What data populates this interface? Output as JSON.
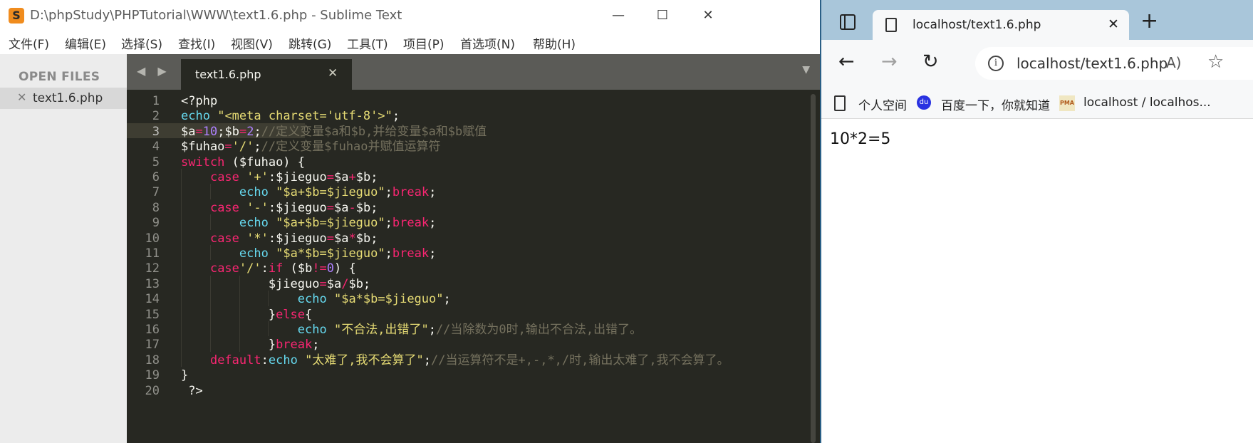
{
  "sublime": {
    "title": "D:\\phpStudy\\PHPTutorial\\WWW\\text1.6.php - Sublime Text",
    "app_icon_glyph": "S",
    "controls": {
      "minimize": "—",
      "maximize": "☐",
      "close": "✕"
    },
    "menu": [
      "文件(F)",
      "编辑(E)",
      "选择(S)",
      "查找(I)",
      "视图(V)",
      "跳转(G)",
      "工具(T)",
      "项目(P)",
      "首选项(N)",
      "帮助(H)"
    ],
    "sidebar": {
      "header": "OPEN FILES",
      "file_close": "✕",
      "file": "text1.6.php"
    },
    "tabbar": {
      "arrows": "◀ ▶",
      "tab_label": "text1.6.php",
      "tab_close": "✕",
      "dropdown": "▼"
    },
    "active_line": 3,
    "code": [
      [
        [
          "plain",
          "<?php"
        ]
      ],
      [
        [
          "fn",
          "echo"
        ],
        [
          "plain",
          " "
        ],
        [
          "str",
          "\"<meta charset='utf-8'>\""
        ],
        [
          "plain",
          ";"
        ]
      ],
      [
        [
          "plain",
          "$a"
        ],
        [
          "op",
          "="
        ],
        [
          "num",
          "10"
        ],
        [
          "plain",
          ";$b"
        ],
        [
          "op",
          "="
        ],
        [
          "num",
          "2"
        ],
        [
          "plain",
          ";"
        ],
        [
          "cmt",
          "//定义变量$a和$b,并给变量$a和$b赋值"
        ]
      ],
      [
        [
          "plain",
          "$fuhao"
        ],
        [
          "op",
          "="
        ],
        [
          "str",
          "'/'"
        ],
        [
          "plain",
          ";"
        ],
        [
          "cmt",
          "//定义变量$fuhao并赋值运算符"
        ]
      ],
      [
        [
          "kw",
          "switch"
        ],
        [
          "plain",
          " ($fuhao) {"
        ]
      ],
      [
        [
          "plain",
          "    "
        ],
        [
          "kw",
          "case"
        ],
        [
          "plain",
          " "
        ],
        [
          "str",
          "'+'"
        ],
        [
          "plain",
          ":$jieguo"
        ],
        [
          "op",
          "="
        ],
        [
          "plain",
          "$a"
        ],
        [
          "op",
          "+"
        ],
        [
          "plain",
          "$b;"
        ]
      ],
      [
        [
          "plain",
          "        "
        ],
        [
          "fn",
          "echo"
        ],
        [
          "plain",
          " "
        ],
        [
          "str",
          "\"$a+$b=$jieguo\""
        ],
        [
          "plain",
          ";"
        ],
        [
          "kw",
          "break"
        ],
        [
          "plain",
          ";"
        ]
      ],
      [
        [
          "plain",
          "    "
        ],
        [
          "kw",
          "case"
        ],
        [
          "plain",
          " "
        ],
        [
          "str",
          "'-'"
        ],
        [
          "plain",
          ":$jieguo"
        ],
        [
          "op",
          "="
        ],
        [
          "plain",
          "$a"
        ],
        [
          "op",
          "-"
        ],
        [
          "plain",
          "$b;"
        ]
      ],
      [
        [
          "plain",
          "        "
        ],
        [
          "fn",
          "echo"
        ],
        [
          "plain",
          " "
        ],
        [
          "str",
          "\"$a+$b=$jieguo\""
        ],
        [
          "plain",
          ";"
        ],
        [
          "kw",
          "break"
        ],
        [
          "plain",
          ";"
        ]
      ],
      [
        [
          "plain",
          "    "
        ],
        [
          "kw",
          "case"
        ],
        [
          "plain",
          " "
        ],
        [
          "str",
          "'*'"
        ],
        [
          "plain",
          ":$jieguo"
        ],
        [
          "op",
          "="
        ],
        [
          "plain",
          "$a"
        ],
        [
          "op",
          "*"
        ],
        [
          "plain",
          "$b;"
        ]
      ],
      [
        [
          "plain",
          "        "
        ],
        [
          "fn",
          "echo"
        ],
        [
          "plain",
          " "
        ],
        [
          "str",
          "\"$a*$b=$jieguo\""
        ],
        [
          "plain",
          ";"
        ],
        [
          "kw",
          "break"
        ],
        [
          "plain",
          ";"
        ]
      ],
      [
        [
          "plain",
          "    "
        ],
        [
          "kw",
          "case"
        ],
        [
          "str",
          "'/'"
        ],
        [
          "plain",
          ":"
        ],
        [
          "kw",
          "if"
        ],
        [
          "plain",
          " ($b"
        ],
        [
          "op",
          "!="
        ],
        [
          "num",
          "0"
        ],
        [
          "plain",
          ") {"
        ]
      ],
      [
        [
          "plain",
          "            $jieguo"
        ],
        [
          "op",
          "="
        ],
        [
          "plain",
          "$a"
        ],
        [
          "op",
          "/"
        ],
        [
          "plain",
          "$b;"
        ]
      ],
      [
        [
          "plain",
          "                "
        ],
        [
          "fn",
          "echo"
        ],
        [
          "plain",
          " "
        ],
        [
          "str",
          "\"$a*$b=$jieguo\""
        ],
        [
          "plain",
          ";"
        ]
      ],
      [
        [
          "plain",
          "            }"
        ],
        [
          "kw",
          "else"
        ],
        [
          "plain",
          "{"
        ]
      ],
      [
        [
          "plain",
          "                "
        ],
        [
          "fn",
          "echo"
        ],
        [
          "plain",
          " "
        ],
        [
          "str",
          "\"不合法,出错了\""
        ],
        [
          "plain",
          ";"
        ],
        [
          "cmt",
          "//当除数为0时,输出不合法,出错了。"
        ]
      ],
      [
        [
          "plain",
          "            }"
        ],
        [
          "kw",
          "break"
        ],
        [
          "plain",
          ";"
        ]
      ],
      [
        [
          "plain",
          "    "
        ],
        [
          "kw",
          "default"
        ],
        [
          "plain",
          ":"
        ],
        [
          "fn",
          "echo"
        ],
        [
          "plain",
          " "
        ],
        [
          "str",
          "\"太难了,我不会算了\""
        ],
        [
          "plain",
          ";"
        ],
        [
          "cmt",
          "//当运算符不是+,-,*,/时,输出太难了,我不会算了。"
        ]
      ],
      [
        [
          "plain",
          "}"
        ]
      ],
      [
        [
          "plain",
          " ?>"
        ]
      ]
    ],
    "colors": {
      "bg": "#272822",
      "plain": "#f8f8f2",
      "keyword": "#f92672",
      "function": "#66d9ef",
      "string": "#e6db74",
      "number": "#ae81ff",
      "comment": "#75715e"
    }
  },
  "browser": {
    "tab_label": "localhost/text1.6.php",
    "tab_close": "✕",
    "new_tab": "+",
    "nav": {
      "back": "←",
      "forward": "→",
      "reload": "↻"
    },
    "address": "localhost/text1.6.php",
    "info_glyph": "i",
    "read_aloud": "A)",
    "favorite": "☆",
    "bookmarks": [
      {
        "label": "个人空间",
        "icon": "page-icon"
      },
      {
        "label": "百度一下，你就知道",
        "icon": "baidu-icon",
        "glyph": "du"
      },
      {
        "label": "localhost / localhos...",
        "icon": "phpmyadmin-icon",
        "glyph": "PMA"
      }
    ],
    "output": "10*2=5",
    "colors": {
      "tabstrip": "#a9c6da",
      "toolbar": "#f7f8f9"
    }
  }
}
